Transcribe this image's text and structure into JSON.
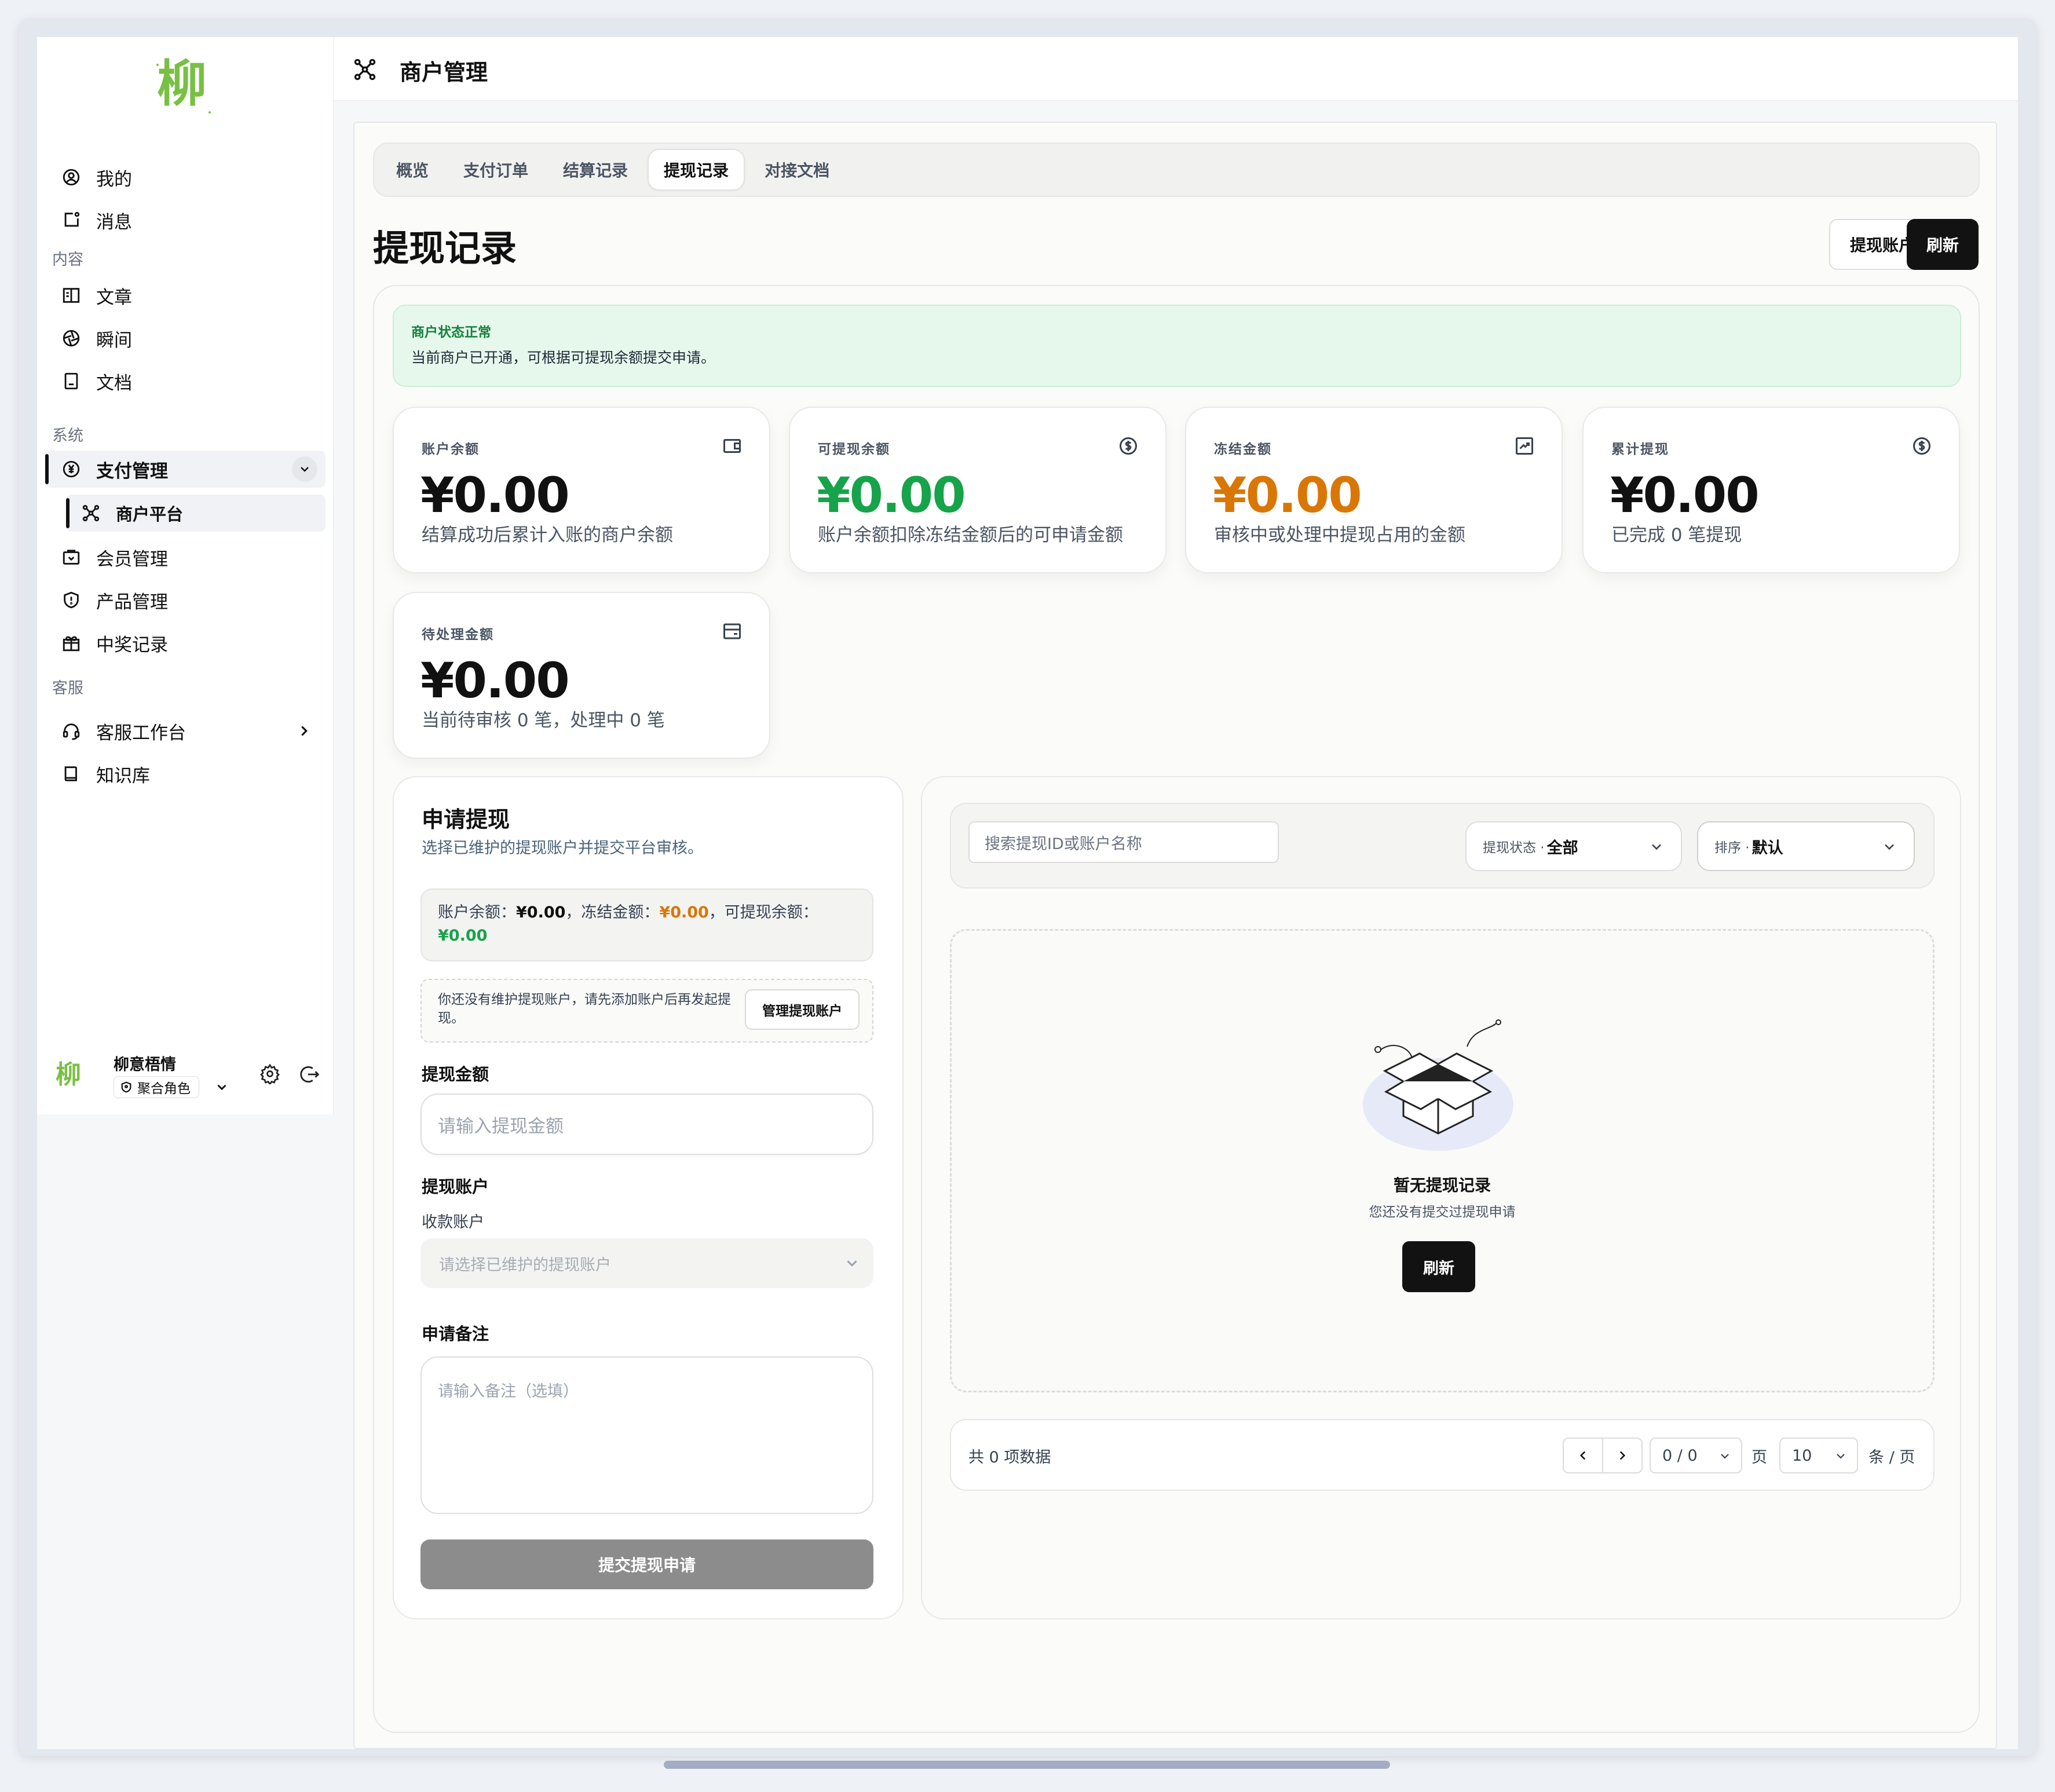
{
  "sidebar": {
    "logo_char": "柳",
    "items_top": [
      {
        "label": "我的",
        "icon": "user-circle-icon"
      },
      {
        "label": "消息",
        "icon": "message-icon"
      }
    ],
    "section_content": "内容",
    "items_content": [
      {
        "label": "文章",
        "icon": "article-icon"
      },
      {
        "label": "瞬间",
        "icon": "moments-icon"
      },
      {
        "label": "文档",
        "icon": "document-icon"
      }
    ],
    "section_system": "系统",
    "pay_mgmt": "支付管理",
    "merchant_platform": "商户平台",
    "items_system": [
      {
        "label": "会员管理",
        "icon": "member-icon"
      },
      {
        "label": "产品管理",
        "icon": "shield-icon"
      },
      {
        "label": "中奖记录",
        "icon": "gift-icon"
      }
    ],
    "section_service": "客服",
    "service_workbench": "客服工作台",
    "knowledge_base": "知识库",
    "user": {
      "name": "柳意梧情",
      "role": "聚合角色",
      "avatar_char": "柳"
    }
  },
  "header": {
    "title": "商户管理"
  },
  "tabs": [
    {
      "label": "概览",
      "active": false
    },
    {
      "label": "支付订单",
      "active": false
    },
    {
      "label": "结算记录",
      "active": false
    },
    {
      "label": "提现记录",
      "active": true
    },
    {
      "label": "对接文档",
      "active": false
    }
  ],
  "page": {
    "title": "提现记录",
    "withdraw_account_btn": "提现账户",
    "refresh_btn": "刷新"
  },
  "banner": {
    "title": "商户状态正常",
    "desc": "当前商户已开通，可根据可提现余额提交申请。"
  },
  "stats": [
    {
      "label": "账户余额",
      "value": "¥0.00",
      "desc": "结算成功后累计入账的商户余额",
      "color": "#111111",
      "icon": "wallet-icon"
    },
    {
      "label": "可提现余额",
      "value": "¥0.00",
      "desc": "账户余额扣除冻结金额后的可申请金额",
      "color": "#16a34a",
      "icon": "dollar-circle-icon"
    },
    {
      "label": "冻结金额",
      "value": "¥0.00",
      "desc": "审核中或处理中提现占用的金额",
      "color": "#d97706",
      "icon": "trend-icon"
    },
    {
      "label": "累计提现",
      "value": "¥0.00",
      "desc": "已完成 0 笔提现",
      "color": "#111111",
      "icon": "dollar-circle-icon"
    },
    {
      "label": "待处理金额",
      "value": "¥0.00",
      "desc": "当前待审核 0 笔，处理中 0 笔",
      "color": "#111111",
      "icon": "card-icon"
    }
  ],
  "apply": {
    "title": "申请提现",
    "subtitle": "选择已维护的提现账户并提交平台审核。",
    "bal_label1": "账户余额：",
    "bal_value1": "¥0.00",
    "bal_label2": "，冻结金额：",
    "bal_value2": "¥0.00",
    "bal_label3": "，可提现余额：",
    "bal_value3": "¥0.00",
    "warn_text": "你还没有维护提现账户，请先添加账户后再发起提现。",
    "manage_btn": "管理提现账户",
    "amount_label": "提现金额",
    "amount_placeholder": "请输入提现金额",
    "account_label": "提现账户",
    "receive_label": "收款账户",
    "receive_placeholder": "请选择已维护的提现账户",
    "remark_label": "申请备注",
    "remark_placeholder": "请输入备注（选填）",
    "submit_btn": "提交提现申请"
  },
  "records": {
    "search_placeholder": "搜索提现ID或账户名称",
    "status_label": "提现状态 ·",
    "status_value": "全部",
    "sort_label": "排序 ·",
    "sort_value": "默认",
    "empty_title": "暂无提现记录",
    "empty_desc": "您还没有提交过提现申请",
    "empty_btn": "刷新",
    "total_text": "共 0 项数据",
    "page_value": "0 / 0",
    "page_unit": "页",
    "page_size": "10",
    "page_size_unit": "条 / 页"
  }
}
